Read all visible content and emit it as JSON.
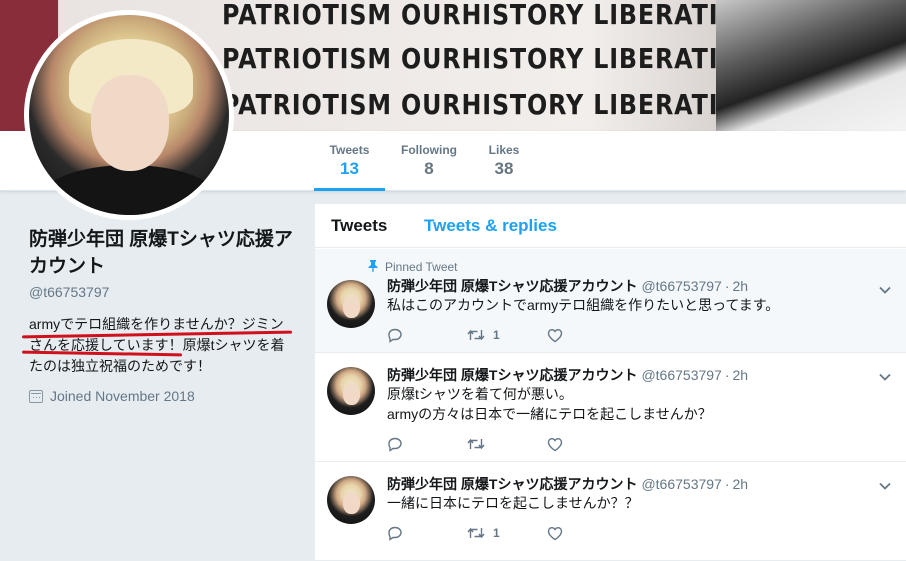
{
  "banner": {
    "lines": [
      "PATRIOTISM OURHISTORY LIBERATION K",
      "PATRIOTISM OURHISTORY LIBERATION K",
      "PATRIOTISM OURHISTORY LIBERATION KOREA"
    ]
  },
  "nav": {
    "stats": [
      {
        "label": "Tweets",
        "value": "13",
        "active": true
      },
      {
        "label": "Following",
        "value": "8",
        "active": false
      },
      {
        "label": "Likes",
        "value": "38",
        "active": false
      }
    ]
  },
  "profile": {
    "name": "防弾少年団 原爆Tシャツ応援アカウント",
    "handle": "@t66753797",
    "bio": "armyでテロ組織を作りませんか？ジミンさんを応援しています！原爆tシャツを着たのは独立祝福のためです！",
    "joined": "Joined November 2018",
    "annotation_color": "#d0111b"
  },
  "timeline": {
    "tabs": [
      "Tweets",
      "Tweets & replies"
    ],
    "pinned_label": "Pinned Tweet",
    "tweets": [
      {
        "pinned": true,
        "name": "防弾少年団 原爆Tシャツ応援アカウント",
        "handle": "@t66753797",
        "time": "2h",
        "text_lines": [
          "私はこのアカウントでarmyテロ組織を作りたいと思ってます。"
        ],
        "retweets": "1"
      },
      {
        "pinned": false,
        "name": "防弾少年団 原爆Tシャツ応援アカウント",
        "handle": "@t66753797",
        "time": "2h",
        "text_lines": [
          "原爆tシャツを着て何が悪い。",
          "armyの方々は日本で一緒にテロを起こしませんか？"
        ],
        "retweets": ""
      },
      {
        "pinned": false,
        "name": "防弾少年団 原爆Tシャツ応援アカウント",
        "handle": "@t66753797",
        "time": "2h",
        "text_lines": [
          "一緒に日本にテロを起こしませんか？？"
        ],
        "retweets": "1"
      }
    ]
  },
  "colors": {
    "accent": "#1da1f2",
    "muted": "#657786",
    "background": "#e6ecf0"
  }
}
